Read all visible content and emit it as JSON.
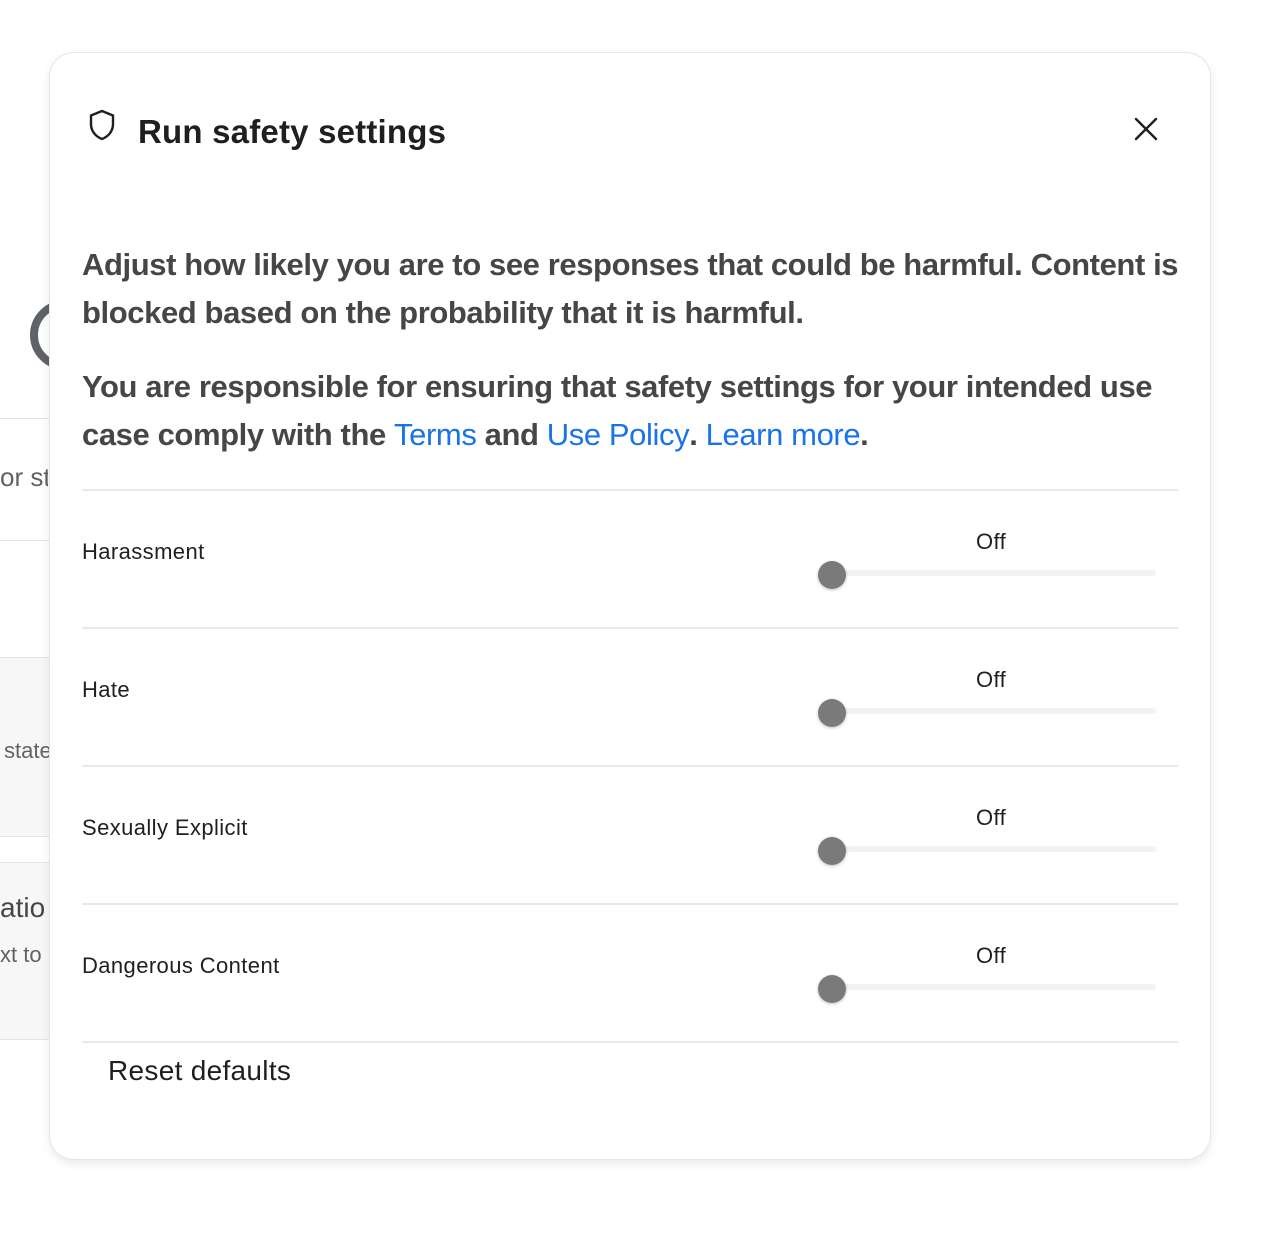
{
  "background": {
    "fragments": [
      "or st",
      "state",
      "atio",
      "xt to"
    ]
  },
  "dialog": {
    "title": "Run safety settings",
    "icon": "shield-icon",
    "close_icon": "close-icon",
    "description_1": "Adjust how likely you are to see responses that could be harmful. Content is blocked based on the probability that it is harmful.",
    "description_2_prefix": "You are responsible for ensuring that safety settings for your intended use case comply with the ",
    "terms_link": "Terms",
    "and_text": " and ",
    "use_policy_link": "Use Policy",
    "period_1": ". ",
    "learn_more_link": "Learn more",
    "period_2": ".",
    "settings": [
      {
        "label": "Harassment",
        "value": "Off",
        "level": 0
      },
      {
        "label": "Hate",
        "value": "Off",
        "level": 0
      },
      {
        "label": "Sexually Explicit",
        "value": "Off",
        "level": 0
      },
      {
        "label": "Dangerous Content",
        "value": "Off",
        "level": 0
      }
    ],
    "reset_label": "Reset defaults"
  },
  "colors": {
    "link": "#1a73e8",
    "thumb": "#7a7a7a",
    "track": "#f2f2f2"
  }
}
